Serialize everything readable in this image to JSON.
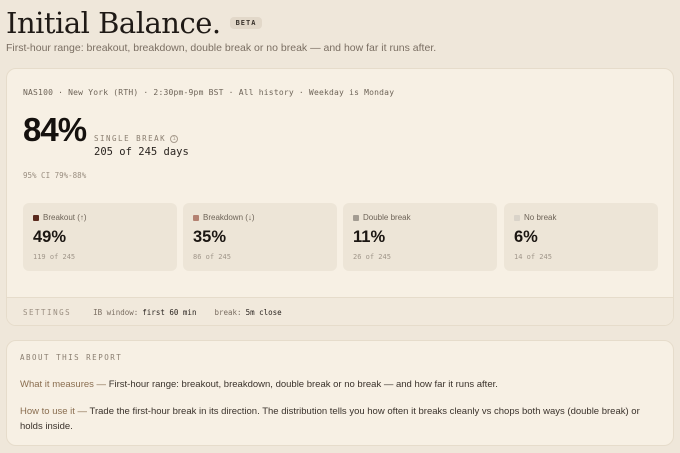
{
  "header": {
    "title": "Initial Balance.",
    "badge": "BETA",
    "subtitle": "First-hour range: breakout, breakdown, double break or no break — and how far it runs after."
  },
  "summary": {
    "meta": "NAS100 · New York (RTH) · 2:30pm-9pm BST · All history · Weekday is Monday",
    "percent": "84%",
    "label": "SINGLE BREAK",
    "info_icon": "info-icon",
    "days": "205 of 245 days",
    "ci": "95% CI 79%-88%"
  },
  "stats": [
    {
      "label": "Breakout (↑)",
      "value": "49%",
      "sub": "119 of 245",
      "color": "#5a2a1e"
    },
    {
      "label": "Breakdown (↓)",
      "value": "35%",
      "sub": "86 of 245",
      "color": "#b48272"
    },
    {
      "label": "Double break",
      "value": "11%",
      "sub": "26 of 245",
      "color": "#a39c92"
    },
    {
      "label": "No break",
      "value": "6%",
      "sub": "14 of 245",
      "color": "#d9d3c9"
    }
  ],
  "settings": {
    "label": "SETTINGS",
    "ib_key": "IB window:",
    "ib_val": "first 60 min",
    "break_key": "break:",
    "break_val": "5m close"
  },
  "about": {
    "title": "ABOUT THIS REPORT",
    "measures_key": "What it measures —",
    "measures_text": " First-hour range: breakout, breakdown, double break or no break — and how far it runs after.",
    "howto_key": "How to use it —",
    "howto_text": " Trade the first-hour break in its direction. The distribution tells you how often it breaks cleanly vs chops both ways (double break) or holds inside."
  }
}
